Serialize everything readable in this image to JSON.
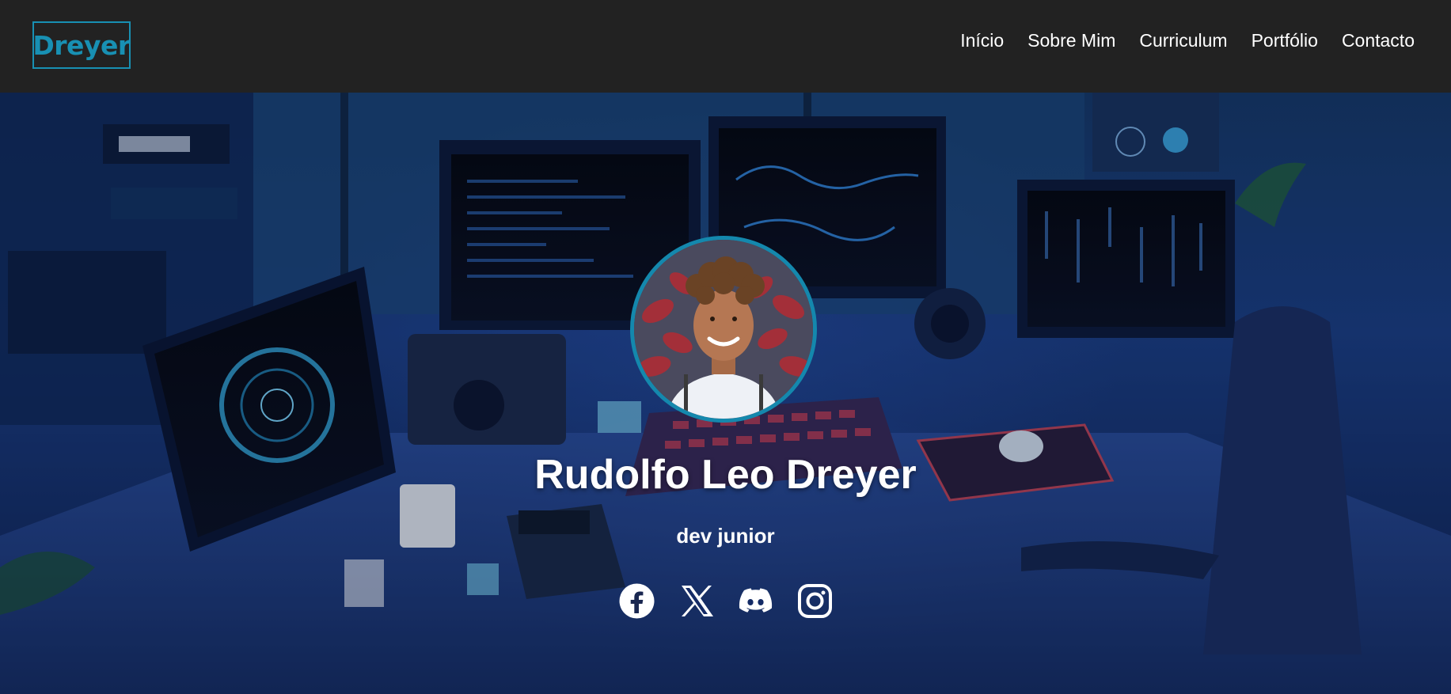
{
  "nav": {
    "logo": "Dreyer",
    "items": [
      {
        "label": "Início"
      },
      {
        "label": "Sobre Mim"
      },
      {
        "label": "Curriculum"
      },
      {
        "label": "Portfólio"
      },
      {
        "label": "Contacto"
      }
    ]
  },
  "hero": {
    "name": "Rudolfo Leo Dreyer",
    "role": "dev junior",
    "socials": [
      {
        "icon": "facebook-icon"
      },
      {
        "icon": "x-icon"
      },
      {
        "icon": "discord-icon"
      },
      {
        "icon": "instagram-icon"
      }
    ]
  },
  "colors": {
    "nav_bg": "#222222",
    "accent": "#1890b3",
    "text": "#ffffff"
  }
}
